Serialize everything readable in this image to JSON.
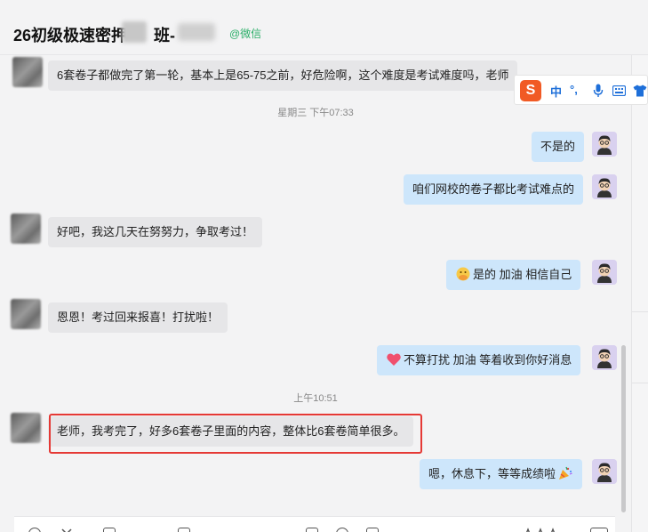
{
  "header": {
    "title": "26初级极速密押",
    "title_suffix": "班-",
    "source": "@微信"
  },
  "ime": {
    "logo": "S",
    "items": [
      "中",
      "°,",
      "mic-icon",
      "keyboard-icon",
      "shirt-icon"
    ]
  },
  "messages": [
    {
      "side": "left",
      "text": "6套卷子都做完了第一轮，基本上是65-75之前，好危险啊，这个难度是考试难度吗，老师"
    },
    {
      "time": "星期三 下午07:33"
    },
    {
      "side": "right",
      "text": "不是的"
    },
    {
      "side": "right",
      "text": "咱们网校的卷子都比考试难点的"
    },
    {
      "side": "left",
      "text": "好吧，我这几天在努努力，争取考过！"
    },
    {
      "side": "right",
      "emoji": "face-with-hand-icon",
      "text": "是的 加油 相信自己"
    },
    {
      "side": "left",
      "text": "恩恩！考过回来报喜！打扰啦！"
    },
    {
      "side": "right",
      "emoji": "heart-icon",
      "text": "不算打扰 加油 等着收到你好消息"
    },
    {
      "time": "上午10:51"
    },
    {
      "side": "left",
      "text": "老师，我考完了，好多6套卷子里面的内容，整体比6套卷简单很多。"
    },
    {
      "side": "right",
      "text": "嗯，休息下，等等成绩啦",
      "emoji_after": "party-popper-icon"
    }
  ],
  "colors": {
    "left_bubble": "#e6e6e8",
    "right_bubble": "#cde6fb",
    "highlight": "#e53935",
    "wechat": "#2aae67"
  }
}
